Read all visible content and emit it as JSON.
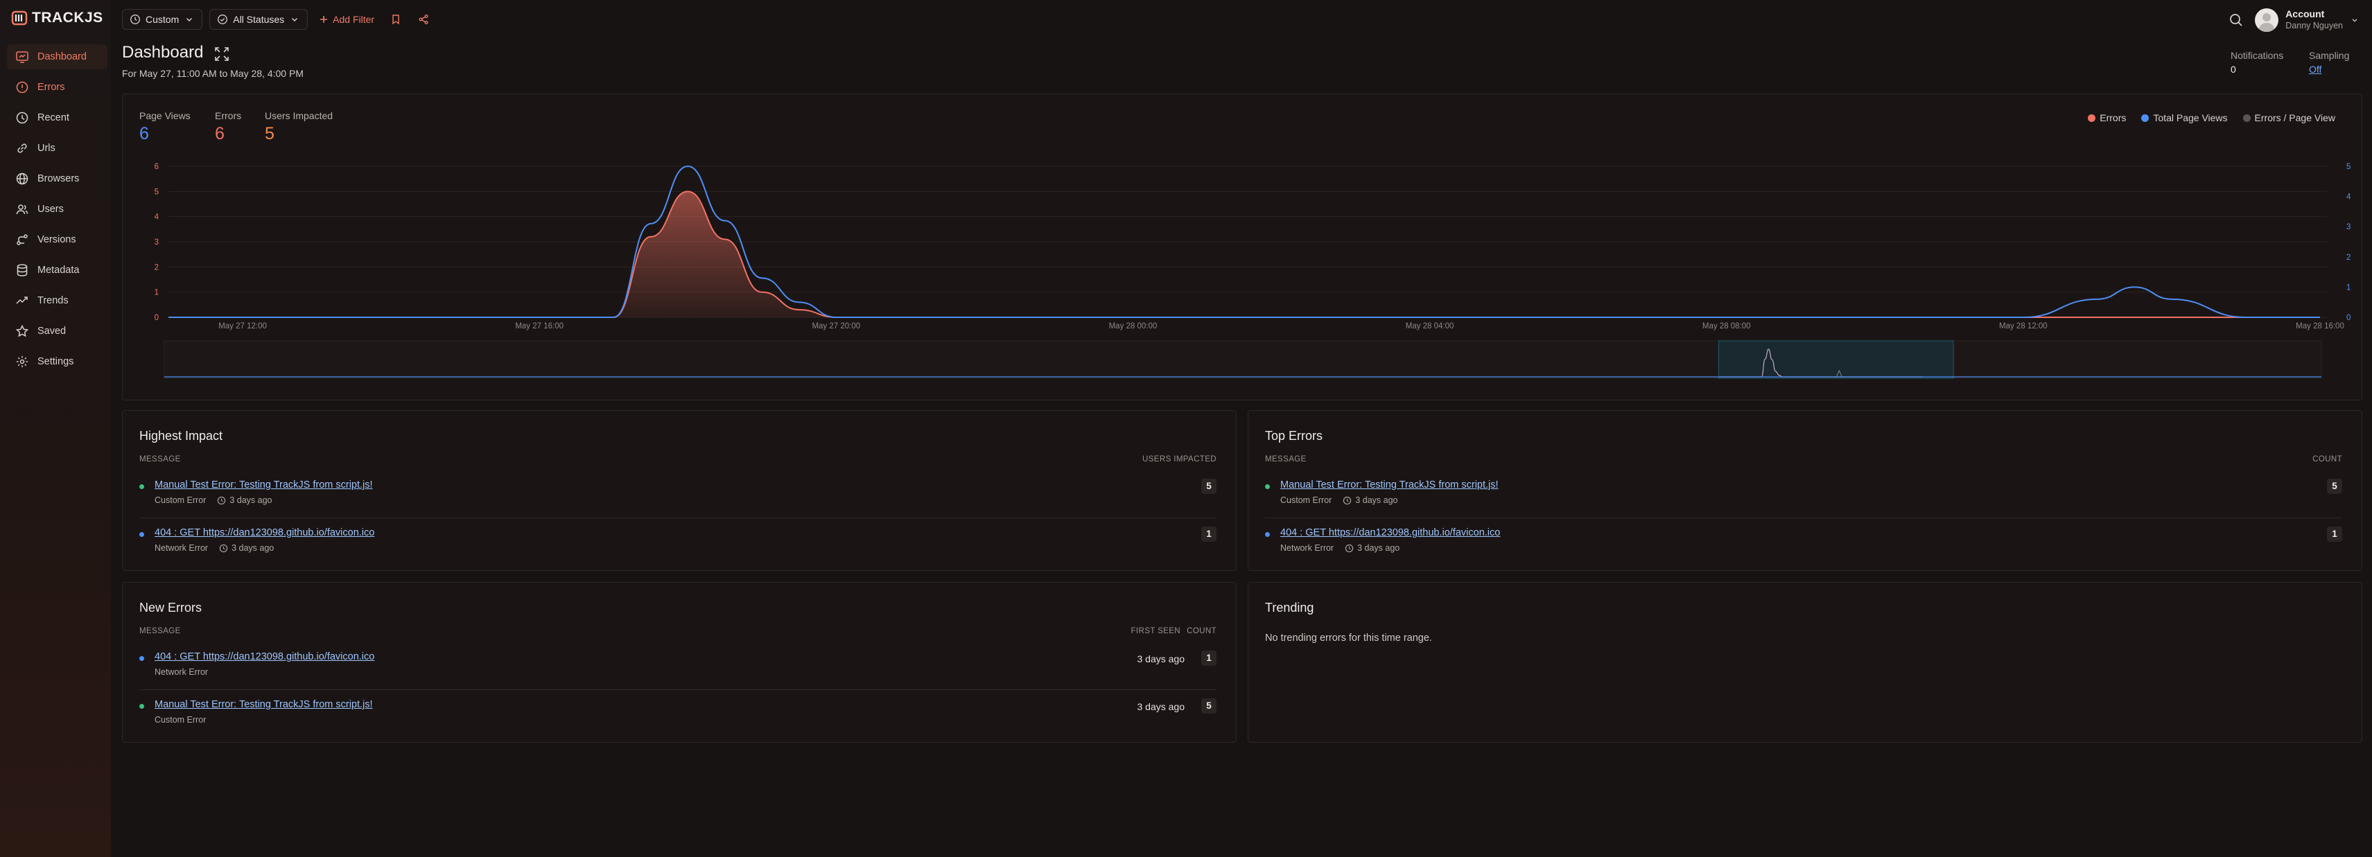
{
  "app": {
    "logo_text": "TRACKJS"
  },
  "sidebar": {
    "items": [
      {
        "label": "Dashboard",
        "icon": "dashboard-icon",
        "active": true
      },
      {
        "label": "Errors",
        "icon": "alert-circle-icon"
      },
      {
        "label": "Recent",
        "icon": "clock-icon"
      },
      {
        "label": "Urls",
        "icon": "link-icon"
      },
      {
        "label": "Browsers",
        "icon": "globe-icon"
      },
      {
        "label": "Users",
        "icon": "users-icon"
      },
      {
        "label": "Versions",
        "icon": "git-branch-icon"
      },
      {
        "label": "Metadata",
        "icon": "database-icon"
      },
      {
        "label": "Trends",
        "icon": "trending-icon"
      },
      {
        "label": "Saved",
        "icon": "star-icon"
      },
      {
        "label": "Settings",
        "icon": "gear-icon"
      }
    ]
  },
  "toolbar": {
    "range_label": "Custom",
    "status_label": "All Statuses",
    "add_filter_label": "Add Filter"
  },
  "account": {
    "title": "Account",
    "name": "Danny Nguyen"
  },
  "header": {
    "title": "Dashboard",
    "date_range": "For May 27, 11:00 AM to May 28, 4:00 PM",
    "notifications_label": "Notifications",
    "notifications_value": "0",
    "sampling_label": "Sampling",
    "sampling_value": "Off"
  },
  "metrics": {
    "page_views_label": "Page Views",
    "page_views_value": "6",
    "errors_label": "Errors",
    "errors_value": "6",
    "users_label": "Users Impacted",
    "users_value": "5"
  },
  "colors": {
    "errors": "#f27263",
    "page_views": "#4f8ff7",
    "users": "#f08a4b",
    "accent": "#f07b66",
    "ratio": "#8a8380"
  },
  "chart_data": {
    "type": "area",
    "legend": [
      "Errors",
      "Total Page Views",
      "Errors / Page View"
    ],
    "legend_placement": "top-right",
    "x_ticks": [
      "May 27 12:00",
      "May 27 16:00",
      "May 27 20:00",
      "May 28 00:00",
      "May 28 04:00",
      "May 28 08:00",
      "May 28 12:00",
      "May 28 16:00"
    ],
    "y_left_ticks": [
      "0",
      "1",
      "2",
      "3",
      "4",
      "5",
      "6"
    ],
    "y_right_ticks": [
      "0",
      "1",
      "2",
      "3",
      "4",
      "5"
    ],
    "ylim_left": [
      0,
      6
    ],
    "ylim_right": [
      0,
      5
    ],
    "x_range_hours": [
      11,
      40
    ],
    "grid": true,
    "series": [
      {
        "name": "Errors",
        "x_hours": [
          11,
          17,
          17.5,
          18,
          18.5,
          19,
          19.5,
          20,
          24,
          40
        ],
        "values": [
          0,
          0,
          3.2,
          5,
          3.1,
          1,
          0.3,
          0,
          0,
          0
        ]
      },
      {
        "name": "Total Page Views",
        "x_hours": [
          11,
          17,
          17.5,
          18,
          18.5,
          19,
          19.5,
          20,
          36,
          37,
          37.5,
          38,
          39,
          40
        ],
        "values": [
          0,
          0,
          3.1,
          5,
          3.2,
          1.3,
          0.5,
          0,
          0,
          0.6,
          1,
          0.6,
          0,
          0
        ]
      }
    ]
  },
  "highest_impact": {
    "title": "Highest Impact",
    "col_message": "MESSAGE",
    "col_value": "USERS IMPACTED",
    "rows": [
      {
        "message": "Manual Test Error: Testing TrackJS from script.js!",
        "type": "Custom Error",
        "ago": "3 days ago",
        "value": "5",
        "color": "#3fbf7f"
      },
      {
        "message": "404 : GET https://dan123098.github.io/favicon.ico",
        "type": "Network Error",
        "ago": "3 days ago",
        "value": "1",
        "color": "#4f8ff7"
      }
    ]
  },
  "top_errors": {
    "title": "Top Errors",
    "col_message": "MESSAGE",
    "col_value": "COUNT",
    "rows": [
      {
        "message": "Manual Test Error: Testing TrackJS from script.js!",
        "type": "Custom Error",
        "ago": "3 days ago",
        "value": "5",
        "color": "#3fbf7f"
      },
      {
        "message": "404 : GET https://dan123098.github.io/favicon.ico",
        "type": "Network Error",
        "ago": "3 days ago",
        "value": "1",
        "color": "#4f8ff7"
      }
    ]
  },
  "new_errors": {
    "title": "New Errors",
    "col_message": "MESSAGE",
    "col_first_seen": "FIRST SEEN",
    "col_count": "COUNT",
    "rows": [
      {
        "message": "404 : GET https://dan123098.github.io/favicon.ico",
        "type": "Network Error",
        "first_seen": "3 days ago",
        "value": "1",
        "color": "#4f8ff7"
      },
      {
        "message": "Manual Test Error: Testing TrackJS from script.js!",
        "type": "Custom Error",
        "first_seen": "3 days ago",
        "value": "5",
        "color": "#3fbf7f"
      }
    ]
  },
  "trending": {
    "title": "Trending",
    "empty": "No trending errors for this time range."
  }
}
